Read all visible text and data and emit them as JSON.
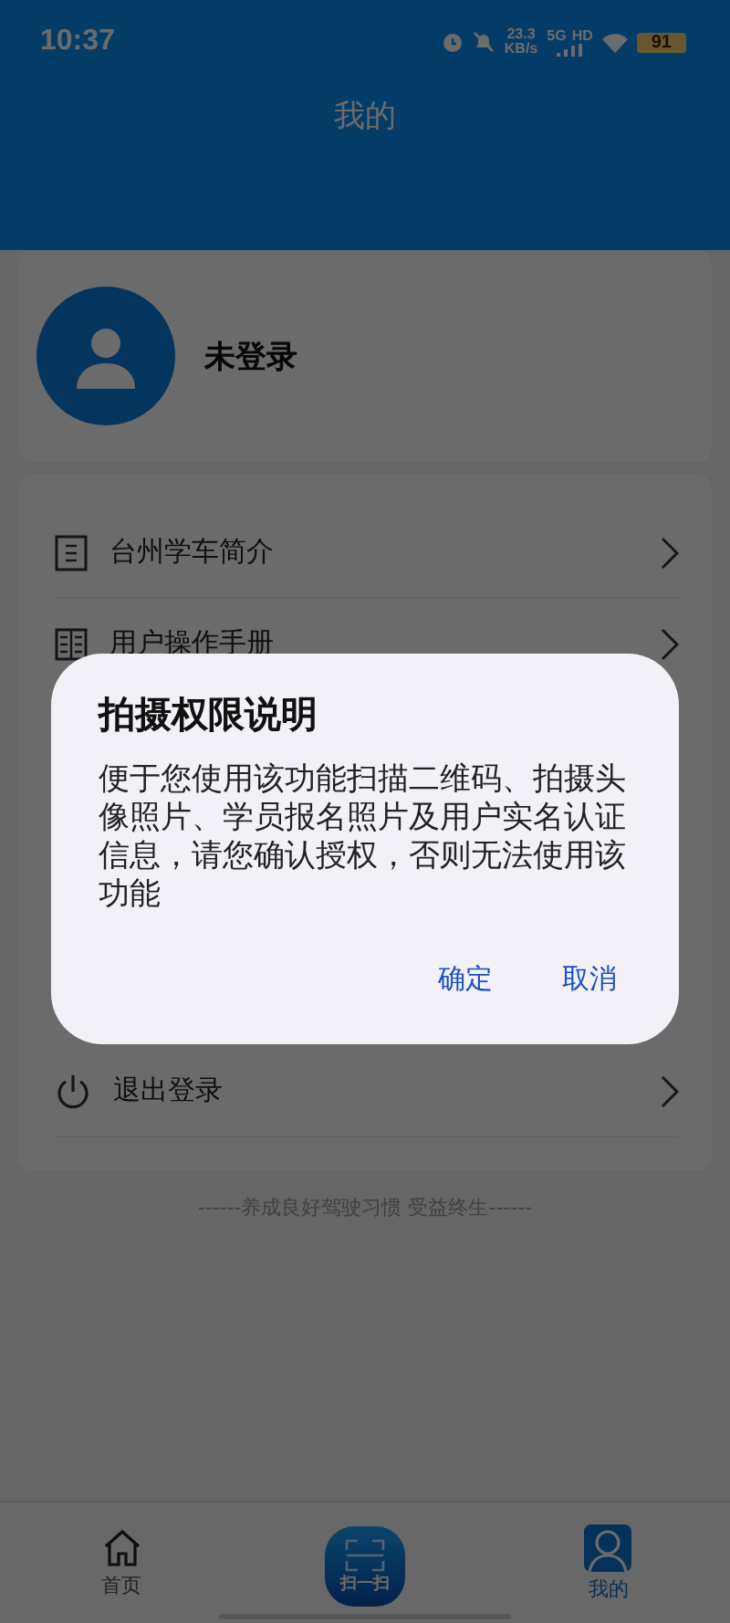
{
  "status_bar": {
    "time": "10:37",
    "speed_value": "23.3",
    "speed_unit": "KB/s",
    "network": "5G",
    "network_extra": "HD",
    "battery": "91"
  },
  "header": {
    "title": "我的"
  },
  "profile": {
    "name": "未登录"
  },
  "menu": [
    {
      "kind": "doc",
      "label": "台州学车简介"
    },
    {
      "kind": "book",
      "label": "用户操作手册"
    },
    {
      "kind": "gap"
    },
    {
      "kind": "power",
      "label": "退出登录"
    }
  ],
  "footer": "------养成良好驾驶习惯 受益终生------",
  "tabs": [
    {
      "kind": "home",
      "label": "首页",
      "selected": false
    },
    {
      "kind": "scan",
      "label": "扫一扫",
      "selected": false
    },
    {
      "kind": "me",
      "label": "我的",
      "selected": true
    }
  ],
  "dialog": {
    "title": "拍摄权限说明",
    "body": "便于您使用该功能扫描二维码、拍摄头像照片、学员报名照片及用户实名认证信息，请您确认授权，否则无法使用该功能",
    "buttons": [
      "确定",
      "取消"
    ]
  }
}
